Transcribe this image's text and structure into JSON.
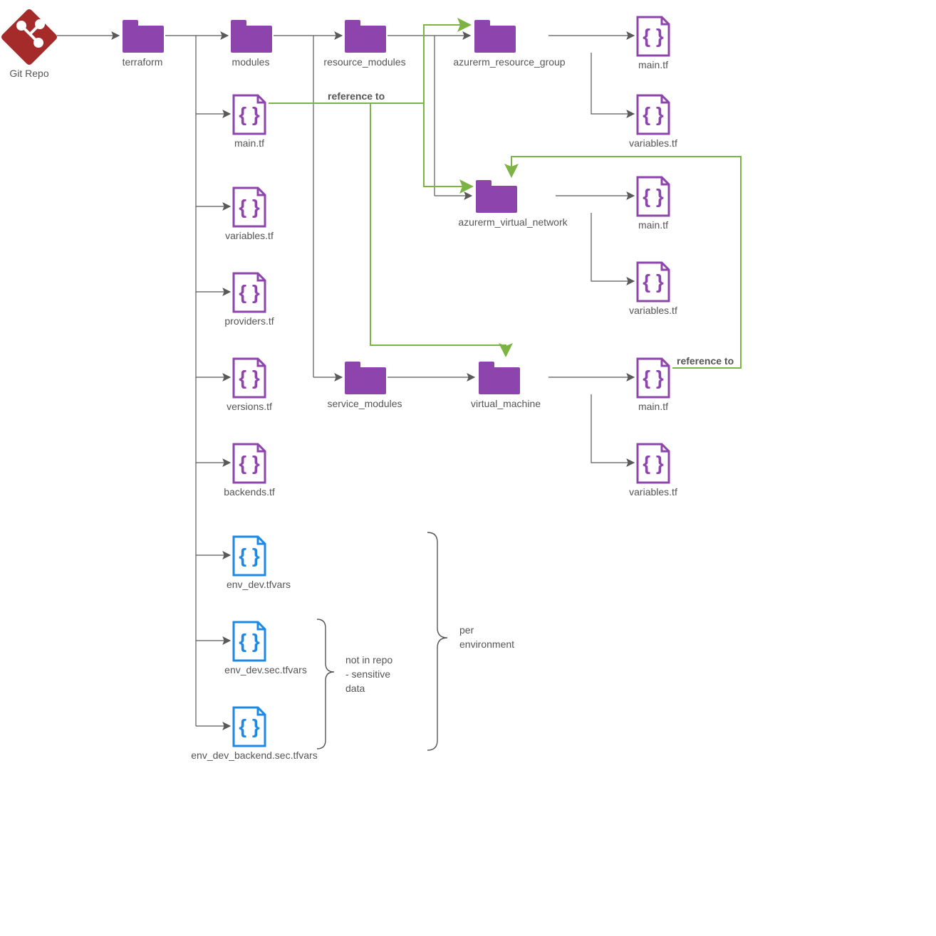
{
  "repoLabel": "Git Repo",
  "folders": {
    "terraform": "terraform",
    "modules": "modules",
    "resource_modules": "resource_modules",
    "service_modules": "service_modules",
    "azurerm_resource_group": "azurerm_resource_group",
    "azurerm_virtual_network": "azurerm_virtual_network",
    "virtual_machine": "virtual_machine"
  },
  "files": {
    "main_tf_root": "main.tf",
    "variables_tf_root": "variables.tf",
    "providers_tf": "providers.tf",
    "versions_tf": "versions.tf",
    "backends_tf": "backends.tf",
    "env_dev_tfvars": "env_dev.tfvars",
    "env_dev_sec_tfvars": "env_dev.sec.tfvars",
    "env_dev_backend_sec_tfvars": "env_dev_backend.sec.tfvars",
    "rg_main_tf": "main.tf",
    "rg_variables_tf": "variables.tf",
    "vn_main_tf": "main.tf",
    "vn_variables_tf": "variables.tf",
    "vm_main_tf": "main.tf",
    "vm_variables_tf": "variables.tf"
  },
  "edgeLabels": {
    "ref1": "reference to",
    "ref2": "reference to"
  },
  "annotations": {
    "per_env_l1": "per",
    "per_env_l2": "environment",
    "not_in_repo_l1": "not in repo",
    "not_in_repo_l2": "- sensitive",
    "not_in_repo_l3": "data"
  },
  "colors": {
    "purple": "#8e44ad",
    "blue": "#1e88e5",
    "gitRed": "#a52a2a",
    "arrow": "#595959",
    "green": "#7cb342",
    "text": "#555"
  }
}
